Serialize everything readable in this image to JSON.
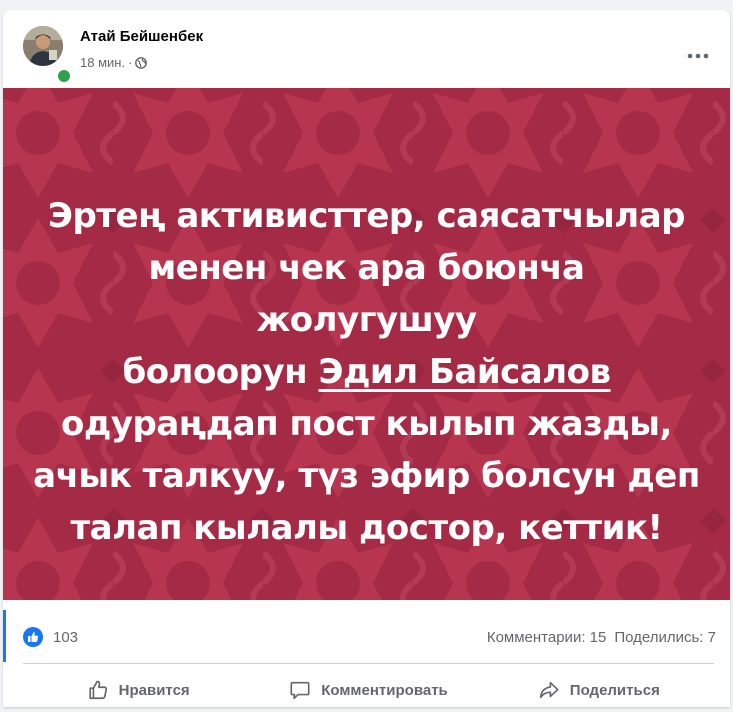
{
  "post": {
    "author": "Атай Бейшенбек",
    "time": "18 мин.",
    "separator": "·",
    "privacy_icon": "globe-icon",
    "menu_icon": "more-horizontal-icon",
    "image_text": {
      "line1": "Эртең активисттер, саясатчылар",
      "line2": "менен чек ара боюнча жолугушуу",
      "line3_before": "болоорун ",
      "mention": "Эдил Байсалов",
      "line4": "одураңдап пост кылып жазды,",
      "line5": "ачык талкуу, түз эфир болсун деп",
      "line6": "талап кылалы достор, кеттик!"
    }
  },
  "stats": {
    "likes": "103",
    "comments": "Комментарии: 15",
    "shares": "Поделились: 7"
  },
  "actions": {
    "like": "Нравится",
    "comment": "Комментировать",
    "share": "Поделиться"
  },
  "colors": {
    "image_background": "#a42a45",
    "brand_blue": "#1877f2",
    "online_green": "#31a24c"
  }
}
